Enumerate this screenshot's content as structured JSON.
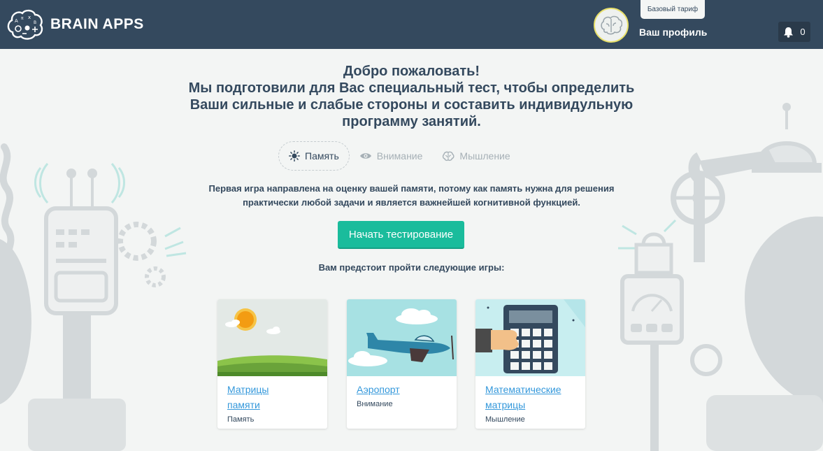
{
  "header": {
    "brand": "BRAIN APPS",
    "plan_badge": "Базовый тариф",
    "profile_link": "Ваш профиль",
    "notifications_count": "0"
  },
  "intro": {
    "greeting": "Добро пожаловать!",
    "line2": "Мы подготовили для Вас специальный тест, чтобы определить",
    "line3": "Ваши сильные и слабые стороны и составить индивидульную",
    "line4": "программу занятий."
  },
  "tabs": [
    {
      "label": "Память",
      "icon": "sun-icon",
      "active": true
    },
    {
      "label": "Внимание",
      "icon": "eye-icon",
      "active": false
    },
    {
      "label": "Мышление",
      "icon": "brain-icon",
      "active": false
    }
  ],
  "description": {
    "line1": "Первая игра направлена на оценку вашей памяти, потому как память нужна для решения",
    "line2": "практически любой задачи и является важнейшей когнитивной функцией."
  },
  "start_button": "Начать тестирование",
  "games_title": "Вам предстоит пройти следующие игры:",
  "games": [
    {
      "title_line1": "Матрицы",
      "title_line2": "памяти",
      "category": "Память"
    },
    {
      "title_line1": "Аэропорт",
      "title_line2": "",
      "category": "Внимание"
    },
    {
      "title_line1": "Математические",
      "title_line2": "матрицы",
      "category": "Мышление"
    }
  ],
  "colors": {
    "header_bg": "#34495e",
    "page_bg": "#f3f5f4",
    "accent": "#1abc9c",
    "link": "#3498db"
  }
}
